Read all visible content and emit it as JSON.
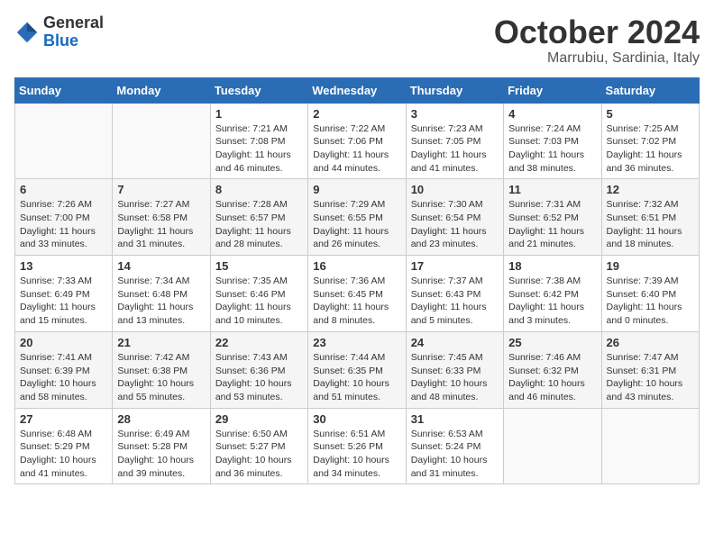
{
  "header": {
    "logo_general": "General",
    "logo_blue": "Blue",
    "month_title": "October 2024",
    "location": "Marrubiu, Sardinia, Italy"
  },
  "days_of_week": [
    "Sunday",
    "Monday",
    "Tuesday",
    "Wednesday",
    "Thursday",
    "Friday",
    "Saturday"
  ],
  "weeks": [
    [
      {
        "day": "",
        "content": ""
      },
      {
        "day": "",
        "content": ""
      },
      {
        "day": "1",
        "content": "Sunrise: 7:21 AM\nSunset: 7:08 PM\nDaylight: 11 hours and 46 minutes."
      },
      {
        "day": "2",
        "content": "Sunrise: 7:22 AM\nSunset: 7:06 PM\nDaylight: 11 hours and 44 minutes."
      },
      {
        "day": "3",
        "content": "Sunrise: 7:23 AM\nSunset: 7:05 PM\nDaylight: 11 hours and 41 minutes."
      },
      {
        "day": "4",
        "content": "Sunrise: 7:24 AM\nSunset: 7:03 PM\nDaylight: 11 hours and 38 minutes."
      },
      {
        "day": "5",
        "content": "Sunrise: 7:25 AM\nSunset: 7:02 PM\nDaylight: 11 hours and 36 minutes."
      }
    ],
    [
      {
        "day": "6",
        "content": "Sunrise: 7:26 AM\nSunset: 7:00 PM\nDaylight: 11 hours and 33 minutes."
      },
      {
        "day": "7",
        "content": "Sunrise: 7:27 AM\nSunset: 6:58 PM\nDaylight: 11 hours and 31 minutes."
      },
      {
        "day": "8",
        "content": "Sunrise: 7:28 AM\nSunset: 6:57 PM\nDaylight: 11 hours and 28 minutes."
      },
      {
        "day": "9",
        "content": "Sunrise: 7:29 AM\nSunset: 6:55 PM\nDaylight: 11 hours and 26 minutes."
      },
      {
        "day": "10",
        "content": "Sunrise: 7:30 AM\nSunset: 6:54 PM\nDaylight: 11 hours and 23 minutes."
      },
      {
        "day": "11",
        "content": "Sunrise: 7:31 AM\nSunset: 6:52 PM\nDaylight: 11 hours and 21 minutes."
      },
      {
        "day": "12",
        "content": "Sunrise: 7:32 AM\nSunset: 6:51 PM\nDaylight: 11 hours and 18 minutes."
      }
    ],
    [
      {
        "day": "13",
        "content": "Sunrise: 7:33 AM\nSunset: 6:49 PM\nDaylight: 11 hours and 15 minutes."
      },
      {
        "day": "14",
        "content": "Sunrise: 7:34 AM\nSunset: 6:48 PM\nDaylight: 11 hours and 13 minutes."
      },
      {
        "day": "15",
        "content": "Sunrise: 7:35 AM\nSunset: 6:46 PM\nDaylight: 11 hours and 10 minutes."
      },
      {
        "day": "16",
        "content": "Sunrise: 7:36 AM\nSunset: 6:45 PM\nDaylight: 11 hours and 8 minutes."
      },
      {
        "day": "17",
        "content": "Sunrise: 7:37 AM\nSunset: 6:43 PM\nDaylight: 11 hours and 5 minutes."
      },
      {
        "day": "18",
        "content": "Sunrise: 7:38 AM\nSunset: 6:42 PM\nDaylight: 11 hours and 3 minutes."
      },
      {
        "day": "19",
        "content": "Sunrise: 7:39 AM\nSunset: 6:40 PM\nDaylight: 11 hours and 0 minutes."
      }
    ],
    [
      {
        "day": "20",
        "content": "Sunrise: 7:41 AM\nSunset: 6:39 PM\nDaylight: 10 hours and 58 minutes."
      },
      {
        "day": "21",
        "content": "Sunrise: 7:42 AM\nSunset: 6:38 PM\nDaylight: 10 hours and 55 minutes."
      },
      {
        "day": "22",
        "content": "Sunrise: 7:43 AM\nSunset: 6:36 PM\nDaylight: 10 hours and 53 minutes."
      },
      {
        "day": "23",
        "content": "Sunrise: 7:44 AM\nSunset: 6:35 PM\nDaylight: 10 hours and 51 minutes."
      },
      {
        "day": "24",
        "content": "Sunrise: 7:45 AM\nSunset: 6:33 PM\nDaylight: 10 hours and 48 minutes."
      },
      {
        "day": "25",
        "content": "Sunrise: 7:46 AM\nSunset: 6:32 PM\nDaylight: 10 hours and 46 minutes."
      },
      {
        "day": "26",
        "content": "Sunrise: 7:47 AM\nSunset: 6:31 PM\nDaylight: 10 hours and 43 minutes."
      }
    ],
    [
      {
        "day": "27",
        "content": "Sunrise: 6:48 AM\nSunset: 5:29 PM\nDaylight: 10 hours and 41 minutes."
      },
      {
        "day": "28",
        "content": "Sunrise: 6:49 AM\nSunset: 5:28 PM\nDaylight: 10 hours and 39 minutes."
      },
      {
        "day": "29",
        "content": "Sunrise: 6:50 AM\nSunset: 5:27 PM\nDaylight: 10 hours and 36 minutes."
      },
      {
        "day": "30",
        "content": "Sunrise: 6:51 AM\nSunset: 5:26 PM\nDaylight: 10 hours and 34 minutes."
      },
      {
        "day": "31",
        "content": "Sunrise: 6:53 AM\nSunset: 5:24 PM\nDaylight: 10 hours and 31 minutes."
      },
      {
        "day": "",
        "content": ""
      },
      {
        "day": "",
        "content": ""
      }
    ]
  ]
}
